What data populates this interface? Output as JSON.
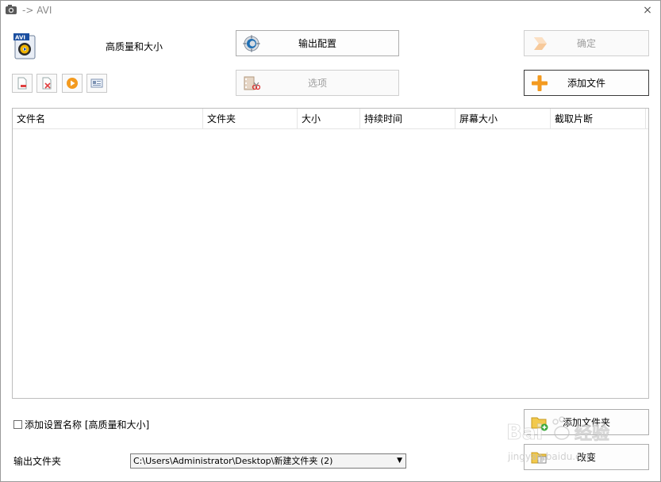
{
  "window": {
    "title": "-> AVI",
    "close_glyph": "×"
  },
  "preset": {
    "icon_label": "AVI",
    "name": "高质量和大小"
  },
  "buttons": {
    "output_config": "输出配置",
    "options": "选项",
    "ok": "确定",
    "add_file": "添加文件",
    "add_folder": "添加文件夹",
    "change": "改变"
  },
  "toolbar": {
    "items": [
      {
        "icon": "remove-file-icon"
      },
      {
        "icon": "delete-icon"
      },
      {
        "icon": "play-icon"
      },
      {
        "icon": "info-icon"
      }
    ]
  },
  "list": {
    "columns": [
      "文件名",
      "文件夹",
      "大小",
      "持续时间",
      "屏幕大小",
      "截取片断"
    ],
    "rows": []
  },
  "settings": {
    "add_setting_name": "添加设置名称 [高质量和大小]",
    "add_setting_checked": false
  },
  "output": {
    "label": "输出文件夹",
    "path": "C:\\Users\\Administrator\\Desktop\\新建文件夹 (2)"
  },
  "watermark": {
    "brand": "Bai",
    "brand2": "经验",
    "url": "jingyan.baidu.com"
  },
  "colors": {
    "accent_orange": "#f39a1f",
    "gear_blue": "#1f6fb4",
    "border": "#adadad",
    "disabled_text": "#9d9d9d"
  }
}
